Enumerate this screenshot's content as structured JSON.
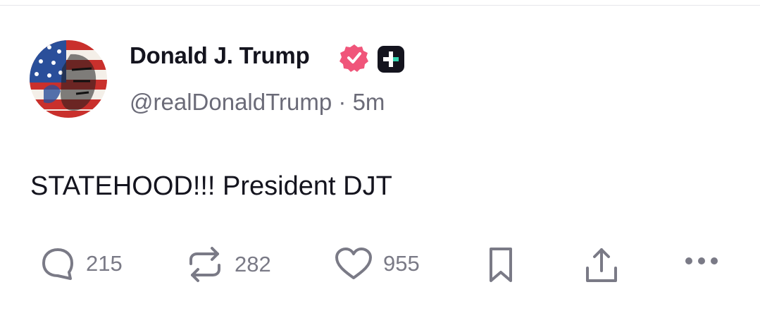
{
  "author": {
    "display_name": "Donald J. Trump",
    "handle": "@realDonaldTrump",
    "separator": "·",
    "time_ago": "5m",
    "verified_icon": "verified-badge-icon",
    "plus_icon": "plus-badge-icon"
  },
  "post": {
    "text": "STATEHOOD!!! President DJT"
  },
  "actions": {
    "replies": "215",
    "reposts": "282",
    "likes": "955"
  },
  "colors": {
    "text_primary": "#14141e",
    "text_secondary": "#6b6b78",
    "icon_gray": "#7a7a86",
    "verified_pink": "#f0557a"
  }
}
